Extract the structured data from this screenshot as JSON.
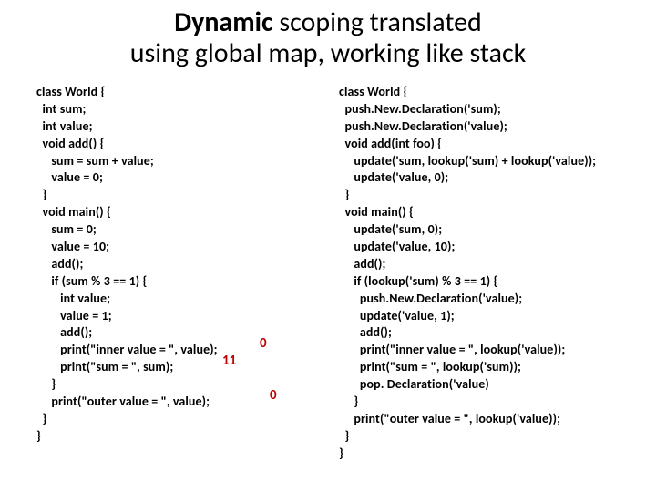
{
  "title": {
    "bold": "Dynamic",
    "rest": " scoping translated\nusing global map, working like stack"
  },
  "left_code": "class World {\n  int sum;\n  int value;\n  void add() {\n     sum = sum + value;\n     value = 0;\n  }\n  void main() {\n     sum = 0;\n     value = 10;\n     add();\n     if (sum % 3 == 1) {\n        int value;\n        value = 1;\n        add();\n        print(\"inner value = \", value);\n        print(\"sum = \", sum);\n     }\n     print(\"outer value = \", value);\n  }\n}",
  "right_code": "class World {\n  push.New.Declaration('sum);\n  push.New.Declaration('value);\n  void add(int foo) {\n     update('sum, lookup('sum) + lookup('value));\n     update('value, 0);\n  }\n  void main() {\n     update('sum, 0);\n     update('value, 10);\n     add();\n     if (lookup('sum) % 3 == 1) {\n       push.New.Declaration('value);\n       update('value, 1);\n       add();\n       print(\"inner value = \", lookup('value));\n       print(\"sum = \", lookup('sum));\n       pop. Declaration('value)\n     }\n     print(\"outer value = \", lookup('value));\n  }\n}",
  "annotations": {
    "inner_value_result": "0",
    "sum_result": "11",
    "outer_value_result": "0"
  }
}
